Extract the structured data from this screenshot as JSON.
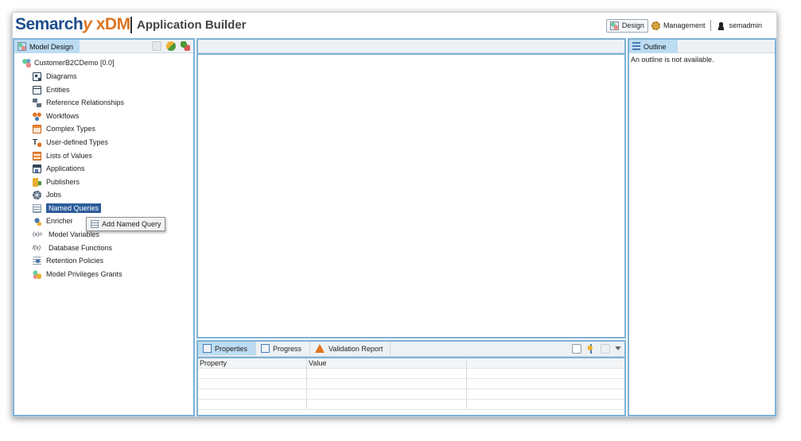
{
  "header": {
    "logo_part1": "Semarch",
    "logo_part2": "y",
    "logo_part3": " xDM",
    "title": "Application Builder",
    "nav": {
      "design": "Design",
      "management": "Management",
      "user": "semadmin"
    }
  },
  "model_design": {
    "tab_label": "Model Design",
    "root": "CustomerB2CDemo [0.0]",
    "items": [
      {
        "label": "Diagrams",
        "icon": "diagram-icon"
      },
      {
        "label": "Entities",
        "icon": "entity-icon"
      },
      {
        "label": "Reference Relationships",
        "icon": "relationship-icon"
      },
      {
        "label": "Workflows",
        "icon": "workflow-icon"
      },
      {
        "label": "Complex Types",
        "icon": "complex-type-icon"
      },
      {
        "label": "User-defined Types",
        "icon": "user-type-icon"
      },
      {
        "label": "Lists of Values",
        "icon": "list-icon"
      },
      {
        "label": "Applications",
        "icon": "application-icon"
      },
      {
        "label": "Publishers",
        "icon": "publisher-icon"
      },
      {
        "label": "Jobs",
        "icon": "gear-icon"
      },
      {
        "label": "Named Queries",
        "icon": "query-icon"
      },
      {
        "label": "Enricher",
        "icon": "enricher-icon"
      },
      {
        "label": "Model Variables",
        "icon": "variable-icon"
      },
      {
        "label": "Database Functions",
        "icon": "function-icon"
      },
      {
        "label": "Retention Policies",
        "icon": "retention-icon"
      },
      {
        "label": "Model Privileges Grants",
        "icon": "privilege-icon"
      }
    ]
  },
  "context_menu": {
    "item": "Add Named Query"
  },
  "outline": {
    "tab_label": "Outline",
    "message": "An outline is not available."
  },
  "properties": {
    "tabs": [
      "Properties",
      "Progress",
      "Validation Report"
    ],
    "columns": [
      "Property",
      "Value",
      ""
    ]
  },
  "colors": {
    "accent": "#7fb2d6",
    "tab_active": "#bcdcf2",
    "selection": "#2b5c9a",
    "brand_blue": "#1e4e8c",
    "brand_orange": "#e0741f"
  }
}
